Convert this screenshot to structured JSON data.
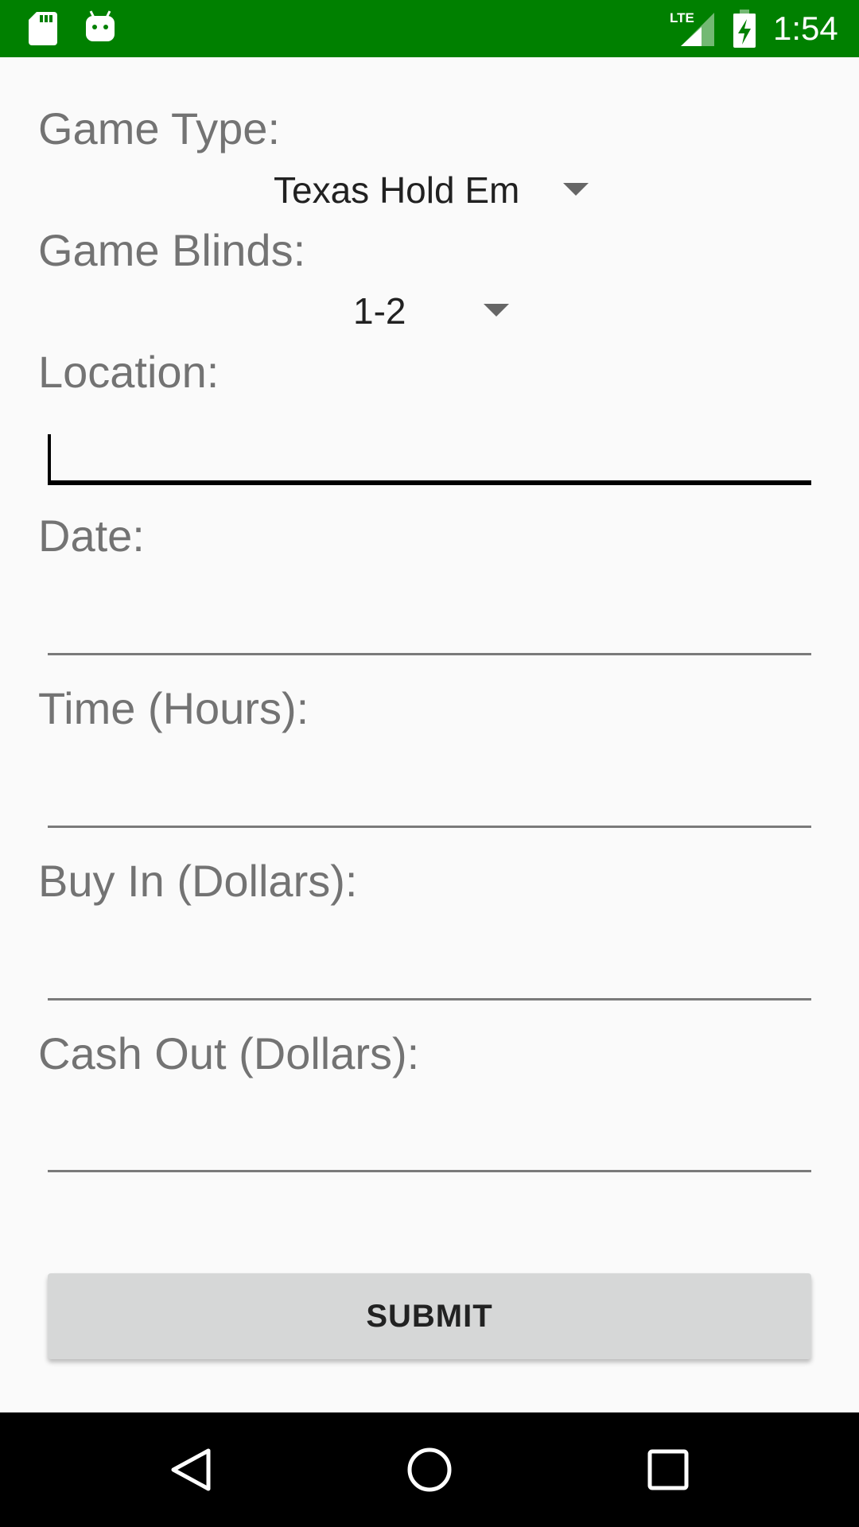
{
  "status_bar": {
    "time": "1:54",
    "network_label": "LTE",
    "background_color": "#008000",
    "icons": [
      "sd-card-icon",
      "android-icon",
      "lte-signal-icon",
      "battery-charging-icon"
    ]
  },
  "form": {
    "game_type": {
      "label": "Game Type:",
      "selected": "Texas Hold Em"
    },
    "game_blinds": {
      "label": "Game Blinds:",
      "selected": "1-2"
    },
    "location": {
      "label": "Location:",
      "value": ""
    },
    "date": {
      "label": "Date:",
      "value": ""
    },
    "time_hours": {
      "label": "Time (Hours):",
      "value": ""
    },
    "buy_in": {
      "label": "Buy In (Dollars):",
      "value": ""
    },
    "cash_out": {
      "label": "Cash Out (Dollars):",
      "value": ""
    },
    "submit_label": "SUBMIT"
  },
  "nav_bar": {
    "icons": [
      "back-icon",
      "home-icon",
      "recents-icon"
    ]
  }
}
